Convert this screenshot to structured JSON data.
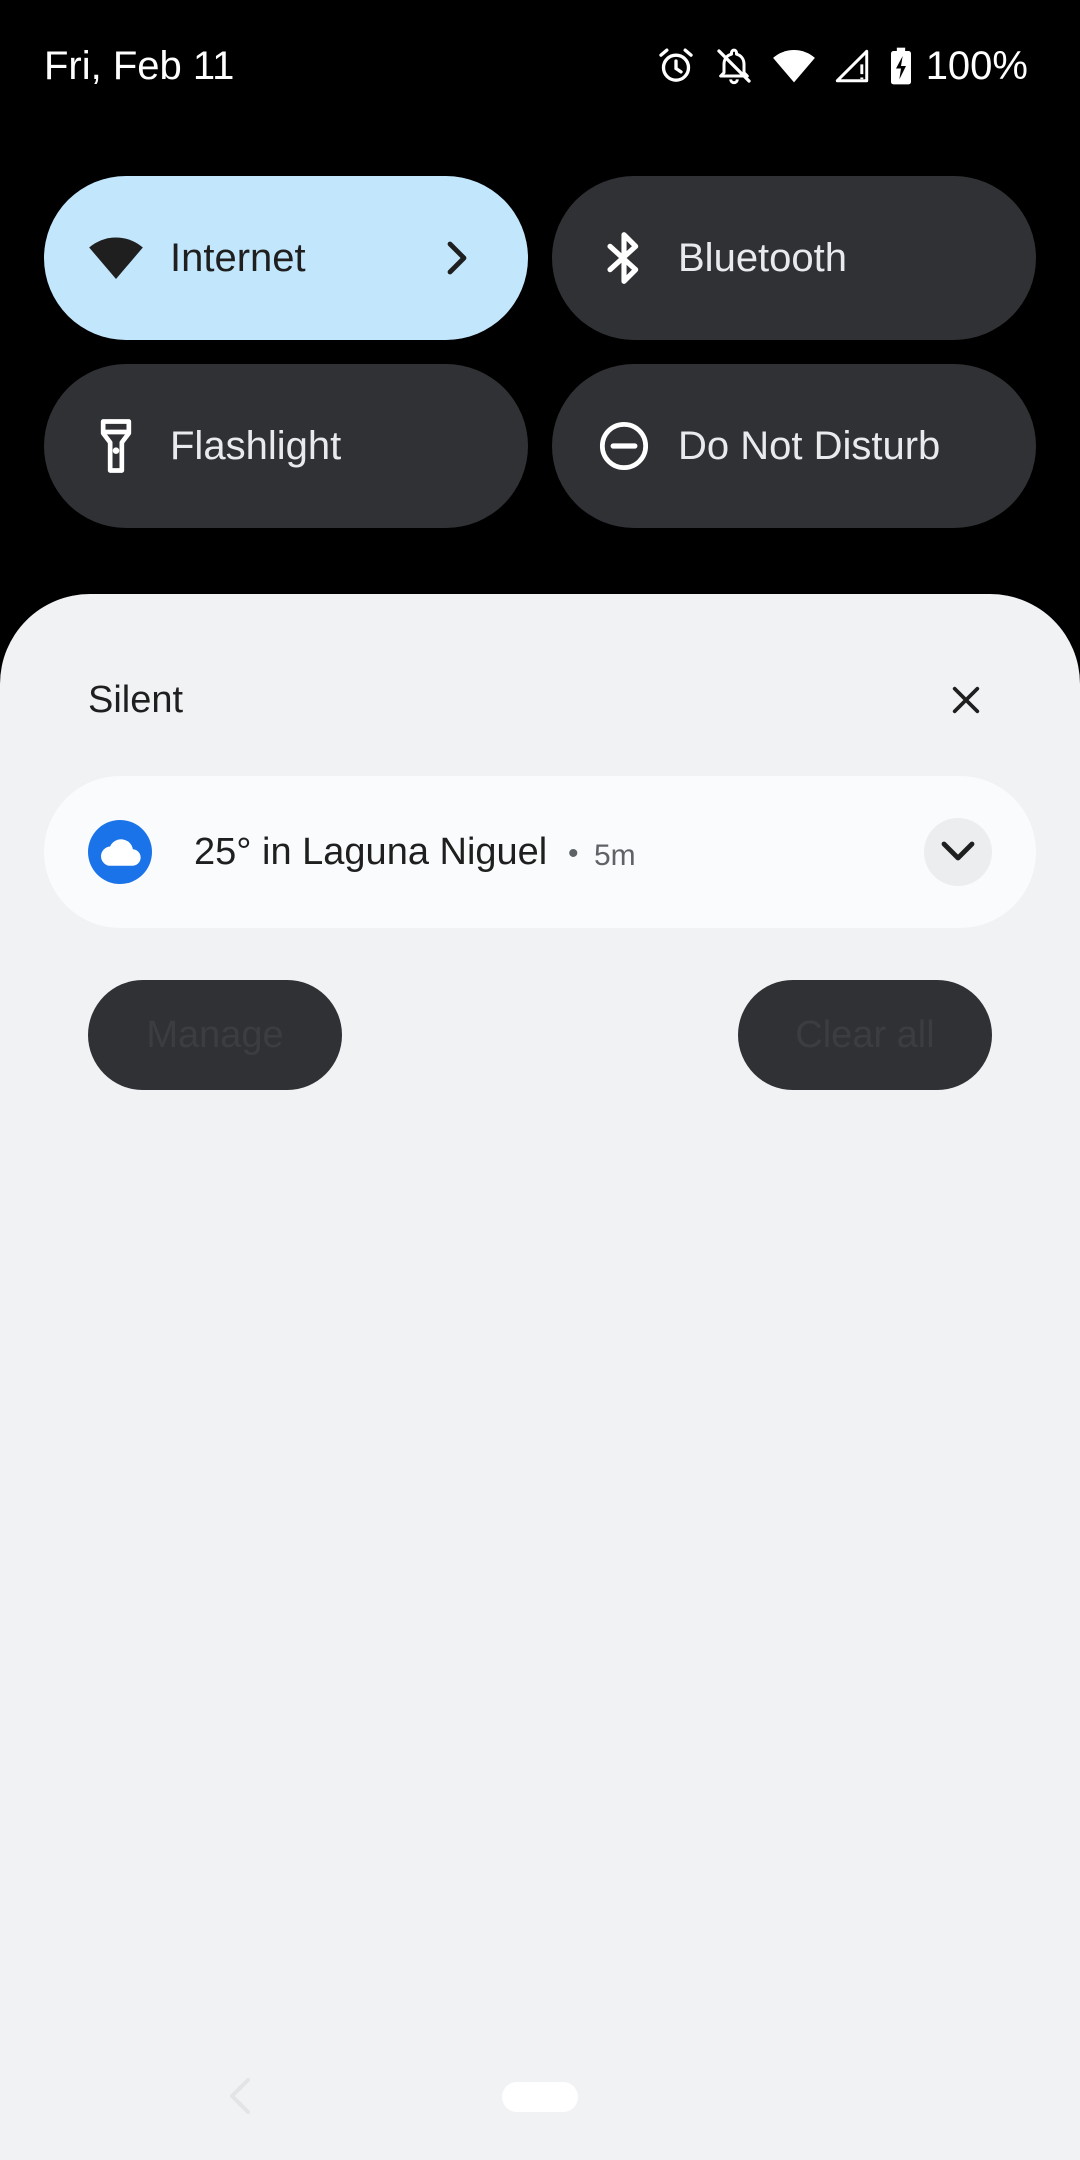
{
  "status_bar": {
    "date": "Fri, Feb 11",
    "battery_percent": "100%",
    "icons": [
      "alarm-icon",
      "bell-off-icon",
      "wifi-icon",
      "cell-signal-icon",
      "battery-charging-icon"
    ]
  },
  "quick_settings": {
    "tiles": [
      {
        "label": "Internet",
        "icon": "wifi-icon",
        "active": true
      },
      {
        "label": "Bluetooth",
        "icon": "bluetooth-icon",
        "active": false
      },
      {
        "label": "Flashlight",
        "icon": "flashlight-icon",
        "active": false
      },
      {
        "label": "Do Not Disturb",
        "icon": "do-not-disturb-icon",
        "active": false
      }
    ]
  },
  "notifications": {
    "section_title": "Silent",
    "items": [
      {
        "title": "25° in Laguna Niguel",
        "separator": "•",
        "time": "5m",
        "app_icon": "cloud-icon"
      }
    ],
    "manage_label": "Manage",
    "clear_all_label": "Clear all"
  },
  "colors": {
    "active_tile": "#c2e7fd",
    "inactive_tile": "#303134",
    "shade_background": "#f1f2f4",
    "weather_icon": "#1a73e8"
  }
}
